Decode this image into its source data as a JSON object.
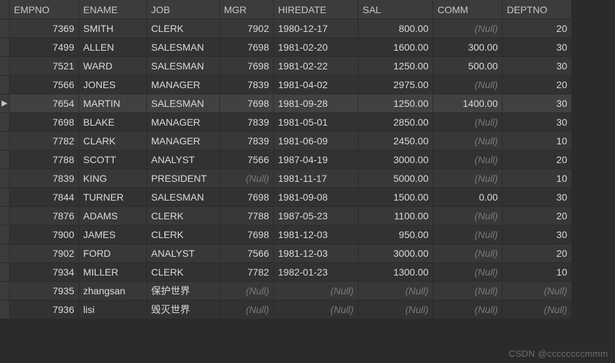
{
  "nullText": "(Null)",
  "selectedRowIndex": 4,
  "watermark": "CSDN @ccccccccmmm",
  "columns": [
    {
      "key": "EMPNO",
      "label": "EMPNO",
      "align": "num"
    },
    {
      "key": "ENAME",
      "label": "ENAME",
      "align": "txt"
    },
    {
      "key": "JOB",
      "label": "JOB",
      "align": "txt"
    },
    {
      "key": "MGR",
      "label": "MGR",
      "align": "num"
    },
    {
      "key": "HIREDATE",
      "label": "HIREDATE",
      "align": "txt"
    },
    {
      "key": "SAL",
      "label": "SAL",
      "align": "num"
    },
    {
      "key": "COMM",
      "label": "COMM",
      "align": "num"
    },
    {
      "key": "DEPTNO",
      "label": "DEPTNO",
      "align": "num"
    }
  ],
  "rows": [
    {
      "EMPNO": "7369",
      "ENAME": "SMITH",
      "JOB": "CLERK",
      "MGR": "7902",
      "HIREDATE": "1980-12-17",
      "SAL": "800.00",
      "COMM": null,
      "DEPTNO": "20"
    },
    {
      "EMPNO": "7499",
      "ENAME": "ALLEN",
      "JOB": "SALESMAN",
      "MGR": "7698",
      "HIREDATE": "1981-02-20",
      "SAL": "1600.00",
      "COMM": "300.00",
      "DEPTNO": "30"
    },
    {
      "EMPNO": "7521",
      "ENAME": "WARD",
      "JOB": "SALESMAN",
      "MGR": "7698",
      "HIREDATE": "1981-02-22",
      "SAL": "1250.00",
      "COMM": "500.00",
      "DEPTNO": "30"
    },
    {
      "EMPNO": "7566",
      "ENAME": "JONES",
      "JOB": "MANAGER",
      "MGR": "7839",
      "HIREDATE": "1981-04-02",
      "SAL": "2975.00",
      "COMM": null,
      "DEPTNO": "20"
    },
    {
      "EMPNO": "7654",
      "ENAME": "MARTIN",
      "JOB": "SALESMAN",
      "MGR": "7698",
      "HIREDATE": "1981-09-28",
      "SAL": "1250.00",
      "COMM": "1400.00",
      "DEPTNO": "30"
    },
    {
      "EMPNO": "7698",
      "ENAME": "BLAKE",
      "JOB": "MANAGER",
      "MGR": "7839",
      "HIREDATE": "1981-05-01",
      "SAL": "2850.00",
      "COMM": null,
      "DEPTNO": "30"
    },
    {
      "EMPNO": "7782",
      "ENAME": "CLARK",
      "JOB": "MANAGER",
      "MGR": "7839",
      "HIREDATE": "1981-06-09",
      "SAL": "2450.00",
      "COMM": null,
      "DEPTNO": "10"
    },
    {
      "EMPNO": "7788",
      "ENAME": "SCOTT",
      "JOB": "ANALYST",
      "MGR": "7566",
      "HIREDATE": "1987-04-19",
      "SAL": "3000.00",
      "COMM": null,
      "DEPTNO": "20"
    },
    {
      "EMPNO": "7839",
      "ENAME": "KING",
      "JOB": "PRESIDENT",
      "MGR": null,
      "HIREDATE": "1981-11-17",
      "SAL": "5000.00",
      "COMM": null,
      "DEPTNO": "10"
    },
    {
      "EMPNO": "7844",
      "ENAME": "TURNER",
      "JOB": "SALESMAN",
      "MGR": "7698",
      "HIREDATE": "1981-09-08",
      "SAL": "1500.00",
      "COMM": "0.00",
      "DEPTNO": "30"
    },
    {
      "EMPNO": "7876",
      "ENAME": "ADAMS",
      "JOB": "CLERK",
      "MGR": "7788",
      "HIREDATE": "1987-05-23",
      "SAL": "1100.00",
      "COMM": null,
      "DEPTNO": "20"
    },
    {
      "EMPNO": "7900",
      "ENAME": "JAMES",
      "JOB": "CLERK",
      "MGR": "7698",
      "HIREDATE": "1981-12-03",
      "SAL": "950.00",
      "COMM": null,
      "DEPTNO": "30"
    },
    {
      "EMPNO": "7902",
      "ENAME": "FORD",
      "JOB": "ANALYST",
      "MGR": "7566",
      "HIREDATE": "1981-12-03",
      "SAL": "3000.00",
      "COMM": null,
      "DEPTNO": "20"
    },
    {
      "EMPNO": "7934",
      "ENAME": "MILLER",
      "JOB": "CLERK",
      "MGR": "7782",
      "HIREDATE": "1982-01-23",
      "SAL": "1300.00",
      "COMM": null,
      "DEPTNO": "10"
    },
    {
      "EMPNO": "7935",
      "ENAME": "zhangsan",
      "JOB": "保护世界",
      "MGR": null,
      "HIREDATE": null,
      "SAL": null,
      "COMM": null,
      "DEPTNO": null
    },
    {
      "EMPNO": "7936",
      "ENAME": "lisi",
      "JOB": "毁灭世界",
      "MGR": null,
      "HIREDATE": null,
      "SAL": null,
      "COMM": null,
      "DEPTNO": null
    }
  ]
}
